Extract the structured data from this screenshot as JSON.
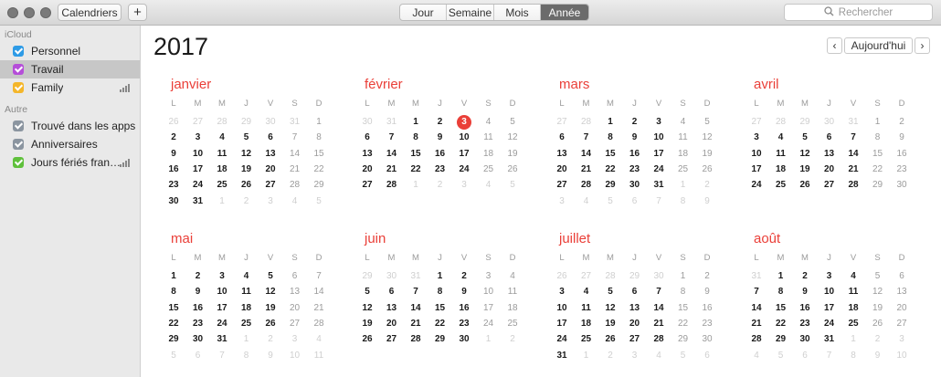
{
  "toolbar": {
    "calendars_label": "Calendriers",
    "add_label": "+",
    "views": [
      "Jour",
      "Semaine",
      "Mois",
      "Année"
    ],
    "active_view": "Année",
    "search_placeholder": "Rechercher"
  },
  "sidebar": {
    "groups": [
      {
        "title": "iCloud",
        "items": [
          {
            "label": "Personnel",
            "color": "#2e9be6",
            "selected": false,
            "shared": false
          },
          {
            "label": "Travail",
            "color": "#b54ed9",
            "selected": true,
            "shared": false
          },
          {
            "label": "Family",
            "color": "#f4b62a",
            "selected": false,
            "shared": true
          }
        ]
      },
      {
        "title": "Autre",
        "items": [
          {
            "label": "Trouvé dans les apps",
            "color": "#8b95a0",
            "selected": false,
            "shared": false
          },
          {
            "label": "Anniversaires",
            "color": "#8b95a0",
            "selected": false,
            "shared": false
          },
          {
            "label": "Jours fériés fran…",
            "color": "#5fc03b",
            "selected": false,
            "shared": true
          }
        ]
      }
    ]
  },
  "main": {
    "year": "2017",
    "prev_label": "‹",
    "today_label": "Aujourd'hui",
    "next_label": "›",
    "weekdays": [
      "L",
      "M",
      "M",
      "J",
      "V",
      "S",
      "D"
    ],
    "today": {
      "month_index": 1,
      "day": "3"
    },
    "months": [
      {
        "name": "janvier",
        "weeks": [
          [
            "26",
            "27",
            "28",
            "29",
            "30",
            "31",
            "1"
          ],
          [
            "2",
            "3",
            "4",
            "5",
            "6",
            "7",
            "8"
          ],
          [
            "9",
            "10",
            "11",
            "12",
            "13",
            "14",
            "15"
          ],
          [
            "16",
            "17",
            "18",
            "19",
            "20",
            "21",
            "22"
          ],
          [
            "23",
            "24",
            "25",
            "26",
            "27",
            "28",
            "29"
          ],
          [
            "30",
            "31",
            "1",
            "2",
            "3",
            "4",
            "5"
          ]
        ],
        "first_in": [
          0,
          6
        ],
        "last_in": [
          5,
          1
        ]
      },
      {
        "name": "février",
        "weeks": [
          [
            "30",
            "31",
            "1",
            "2",
            "3",
            "4",
            "5"
          ],
          [
            "6",
            "7",
            "8",
            "9",
            "10",
            "11",
            "12"
          ],
          [
            "13",
            "14",
            "15",
            "16",
            "17",
            "18",
            "19"
          ],
          [
            "20",
            "21",
            "22",
            "23",
            "24",
            "25",
            "26"
          ],
          [
            "27",
            "28",
            "1",
            "2",
            "3",
            "4",
            "5"
          ]
        ],
        "first_in": [
          0,
          2
        ],
        "last_in": [
          4,
          1
        ]
      },
      {
        "name": "mars",
        "weeks": [
          [
            "27",
            "28",
            "1",
            "2",
            "3",
            "4",
            "5"
          ],
          [
            "6",
            "7",
            "8",
            "9",
            "10",
            "11",
            "12"
          ],
          [
            "13",
            "14",
            "15",
            "16",
            "17",
            "18",
            "19"
          ],
          [
            "20",
            "21",
            "22",
            "23",
            "24",
            "25",
            "26"
          ],
          [
            "27",
            "28",
            "29",
            "30",
            "31",
            "1",
            "2"
          ],
          [
            "3",
            "4",
            "5",
            "6",
            "7",
            "8",
            "9"
          ]
        ],
        "first_in": [
          0,
          2
        ],
        "last_in": [
          4,
          4
        ]
      },
      {
        "name": "avril",
        "weeks": [
          [
            "27",
            "28",
            "29",
            "30",
            "31",
            "1",
            "2"
          ],
          [
            "3",
            "4",
            "5",
            "6",
            "7",
            "8",
            "9"
          ],
          [
            "10",
            "11",
            "12",
            "13",
            "14",
            "15",
            "16"
          ],
          [
            "17",
            "18",
            "19",
            "20",
            "21",
            "22",
            "23"
          ],
          [
            "24",
            "25",
            "26",
            "27",
            "28",
            "29",
            "30"
          ]
        ],
        "first_in": [
          0,
          5
        ],
        "last_in": [
          4,
          6
        ]
      },
      {
        "name": "mai",
        "weeks": [
          [
            "1",
            "2",
            "3",
            "4",
            "5",
            "6",
            "7"
          ],
          [
            "8",
            "9",
            "10",
            "11",
            "12",
            "13",
            "14"
          ],
          [
            "15",
            "16",
            "17",
            "18",
            "19",
            "20",
            "21"
          ],
          [
            "22",
            "23",
            "24",
            "25",
            "26",
            "27",
            "28"
          ],
          [
            "29",
            "30",
            "31",
            "1",
            "2",
            "3",
            "4"
          ],
          [
            "5",
            "6",
            "7",
            "8",
            "9",
            "10",
            "11"
          ]
        ],
        "first_in": [
          0,
          0
        ],
        "last_in": [
          4,
          2
        ]
      },
      {
        "name": "juin",
        "weeks": [
          [
            "29",
            "30",
            "31",
            "1",
            "2",
            "3",
            "4"
          ],
          [
            "5",
            "6",
            "7",
            "8",
            "9",
            "10",
            "11"
          ],
          [
            "12",
            "13",
            "14",
            "15",
            "16",
            "17",
            "18"
          ],
          [
            "19",
            "20",
            "21",
            "22",
            "23",
            "24",
            "25"
          ],
          [
            "26",
            "27",
            "28",
            "29",
            "30",
            "1",
            "2"
          ]
        ],
        "first_in": [
          0,
          3
        ],
        "last_in": [
          4,
          4
        ]
      },
      {
        "name": "juillet",
        "weeks": [
          [
            "26",
            "27",
            "28",
            "29",
            "30",
            "1",
            "2"
          ],
          [
            "3",
            "4",
            "5",
            "6",
            "7",
            "8",
            "9"
          ],
          [
            "10",
            "11",
            "12",
            "13",
            "14",
            "15",
            "16"
          ],
          [
            "17",
            "18",
            "19",
            "20",
            "21",
            "22",
            "23"
          ],
          [
            "24",
            "25",
            "26",
            "27",
            "28",
            "29",
            "30"
          ],
          [
            "31",
            "1",
            "2",
            "3",
            "4",
            "5",
            "6"
          ]
        ],
        "first_in": [
          0,
          5
        ],
        "last_in": [
          5,
          0
        ]
      },
      {
        "name": "août",
        "weeks": [
          [
            "31",
            "1",
            "2",
            "3",
            "4",
            "5",
            "6"
          ],
          [
            "7",
            "8",
            "9",
            "10",
            "11",
            "12",
            "13"
          ],
          [
            "14",
            "15",
            "16",
            "17",
            "18",
            "19",
            "20"
          ],
          [
            "21",
            "22",
            "23",
            "24",
            "25",
            "26",
            "27"
          ],
          [
            "28",
            "29",
            "30",
            "31",
            "1",
            "2",
            "3"
          ],
          [
            "4",
            "5",
            "6",
            "7",
            "8",
            "9",
            "10"
          ]
        ],
        "first_in": [
          0,
          1
        ],
        "last_in": [
          4,
          3
        ]
      }
    ]
  }
}
